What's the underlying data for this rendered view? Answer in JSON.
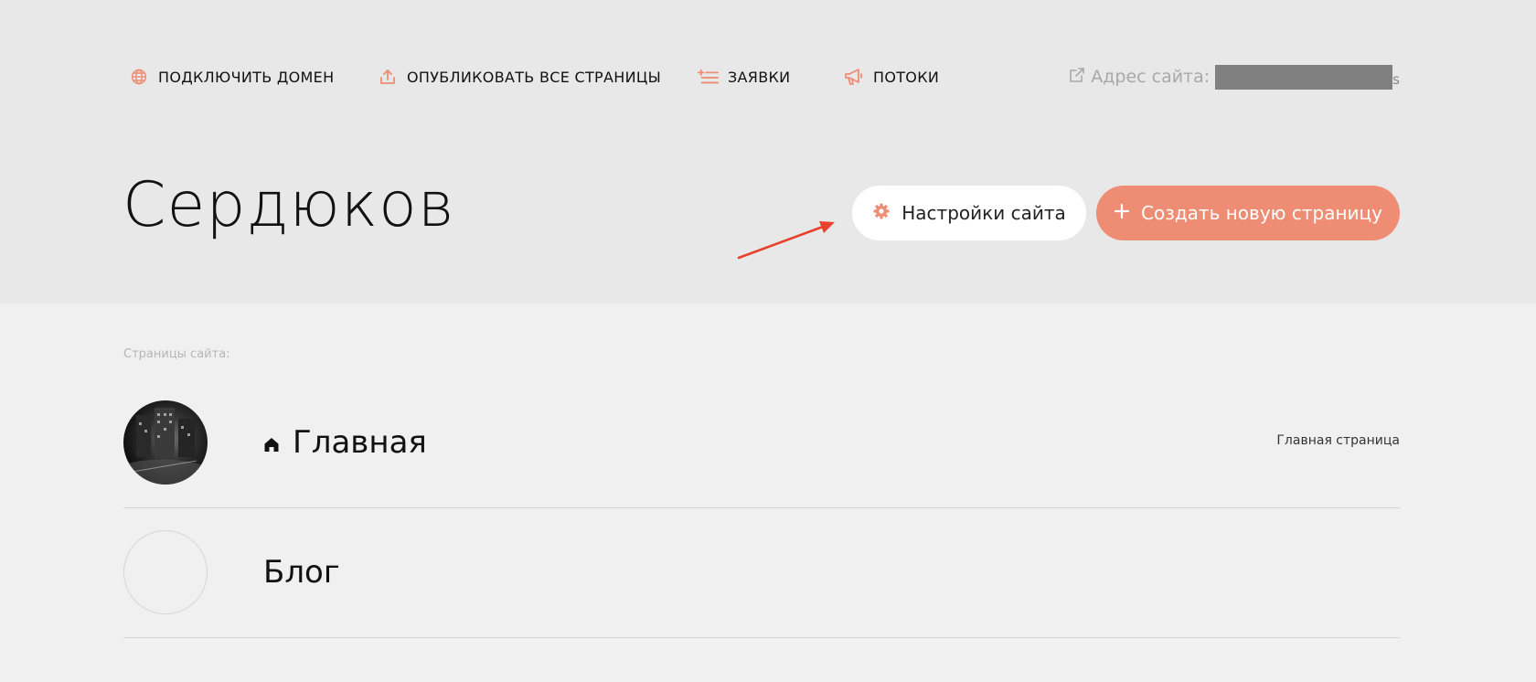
{
  "topnav": {
    "items": [
      {
        "label": "ПОДКЛЮЧИТЬ ДОМЕН",
        "icon": "globe-icon"
      },
      {
        "label": "ОПУБЛИКОВАТЬ ВСЕ СТРАНИЦЫ",
        "icon": "upload-icon"
      },
      {
        "label": "ЗАЯВКИ",
        "icon": "list-add-icon"
      },
      {
        "label": "ПОТОКИ",
        "icon": "megaphone-icon"
      }
    ],
    "address_label": "Адрес сайта:",
    "address_tail": "s"
  },
  "site": {
    "title": "Сердюков"
  },
  "actions": {
    "settings_label": "Настройки сайта",
    "create_label": "Создать новую страницу"
  },
  "pages": {
    "section_label": "Страницы сайта:",
    "items": [
      {
        "name": "Главная",
        "tag": "Главная страница",
        "home": true,
        "thumbnail": "photo"
      },
      {
        "name": "Блог",
        "tag": "",
        "home": false,
        "thumbnail": "empty"
      }
    ]
  },
  "colors": {
    "accent": "#ee8c74",
    "arrow": "#e8412c",
    "header_bg": "#e8e8e8",
    "page_bg": "#f0f0f0"
  }
}
